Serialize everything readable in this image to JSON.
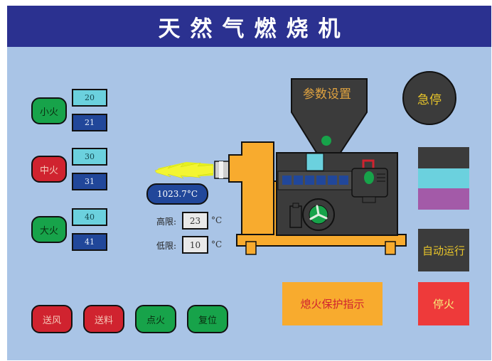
{
  "header": {
    "title": "天然气燃烧机"
  },
  "fire_levels": [
    {
      "label": "小火",
      "color": "green",
      "upper": "20",
      "lower": "21"
    },
    {
      "label": "中火",
      "color": "red",
      "upper": "30",
      "lower": "31"
    },
    {
      "label": "大火",
      "color": "green",
      "upper": "40",
      "lower": "41"
    }
  ],
  "controls": [
    {
      "label": "送风",
      "color": "red"
    },
    {
      "label": "送料",
      "color": "red"
    },
    {
      "label": "点火",
      "color": "green"
    },
    {
      "label": "复位",
      "color": "green"
    }
  ],
  "temperature": {
    "value": "1023.7°C"
  },
  "limits": {
    "high_label": "高限:",
    "high_value": "23",
    "high_unit": "°C",
    "low_label": "低限:",
    "low_value": "10",
    "low_unit": "°C"
  },
  "machine": {
    "hopper_label": "参数设置"
  },
  "emergency_stop": {
    "label": "急停"
  },
  "status_lights": [
    {
      "name": "dark",
      "color": "#3b3b3b"
    },
    {
      "name": "cyan",
      "color": "#6bd1de"
    },
    {
      "name": "purple",
      "color": "#a35aa8"
    }
  ],
  "auto_run": {
    "label": "自动运行"
  },
  "flameout_indicator": {
    "label": "熄火保护指示"
  },
  "stop_fire": {
    "label": "停火"
  },
  "colors": {
    "header": "#2b3190",
    "panel": "#a9c4e6",
    "machine_body": "#f8ab2e",
    "machine_dark": "#3b3b3b"
  }
}
